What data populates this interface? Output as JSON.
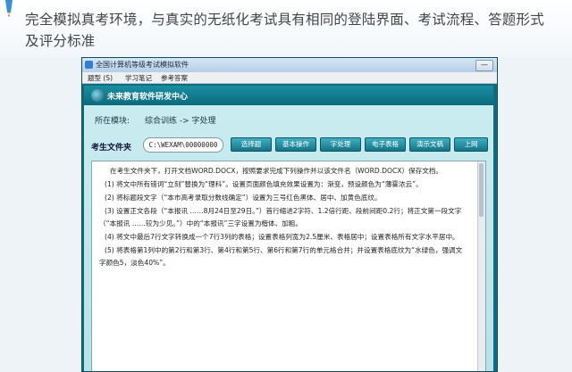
{
  "banner": {
    "line1": "完全模拟真考环境，与真实的无纸化考试具有相同的登陆界面、考试流程、答题形式",
    "line2": "及评分标准"
  },
  "window": {
    "title": "全国计算机等级考试模拟软件",
    "minimize_label": "—"
  },
  "menubar": {
    "items": [
      {
        "label": "题型 (S)"
      },
      {
        "label": "学习笔记"
      },
      {
        "label": "参考答案"
      }
    ]
  },
  "brand": {
    "name": "未来教育软件研发中心"
  },
  "module": {
    "label": "所在模块:",
    "path": "综合训练  ->  字处理"
  },
  "toolbar": {
    "folder_label": "考生文件夹",
    "folder_path": "C:\\WEXAM\\00000000",
    "buttons": [
      {
        "label": "选择题"
      },
      {
        "label": "基本操作"
      },
      {
        "label": "字处理"
      },
      {
        "label": "电子表格"
      },
      {
        "label": "演示文稿"
      },
      {
        "label": "上网"
      }
    ]
  },
  "task": {
    "lines": [
      "在考生文件夹下，打开文档WORD.DOCX，按照要求完成下列操作并以该文件名（WORD.DOCX）保存文档。",
      "(1) 将文中所有错词“立刻”替换为“理科”。设置页面颜色填充效果设置为：渐变，预设颜色为“薄雾浓云”。",
      "(2) 将标题段文字（“本市高考录取分数线确定”）设置为三号红色黑体、居中、加黄色底纹。",
      "(3) 设置正文各段（“本报讯 ……8月24日至29日。”）首行缩进2字符、1.2倍行距、段前间距0.2行；将正文第一段文字",
      "（“本报讯 ……较为少见。”）中的“本报讯”三字设置为楷体、加粗。",
      "(4) 将文中最后7行文字转换成一个7行3列的表格；设置表格列宽为2.5厘米、表格居中；设置表格所有文字水平居中。",
      "(5) 将表格第1列中的第2行和第3行、第4行和第5行、第6行和第7行的单元格合并；并设置表格底纹为“水绿色，强调文",
      "字颜色5，淡色40%”。"
    ]
  },
  "colors": {
    "window_frame": "#0f6b7e",
    "panel": "#c9ecef",
    "button": "#137486"
  }
}
